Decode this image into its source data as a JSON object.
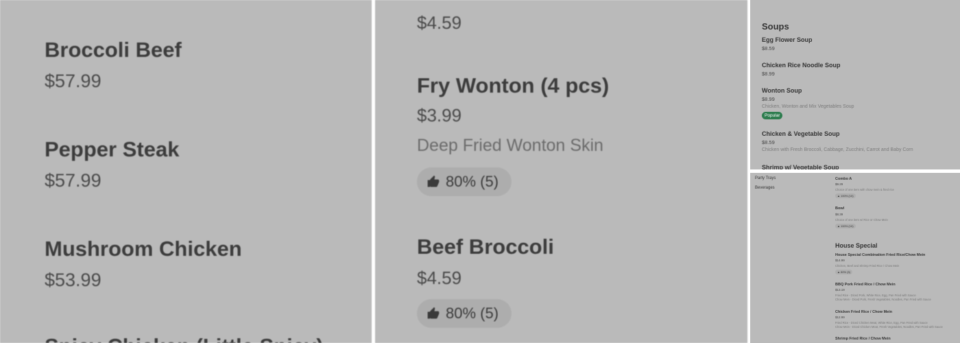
{
  "panel1": {
    "items": [
      {
        "name": "Broccoli Beef",
        "price": "$57.99"
      },
      {
        "name": "Pepper Steak",
        "price": "$57.99"
      },
      {
        "name": "Mushroom Chicken",
        "price": "$53.99"
      },
      {
        "name": "Spicy Chicken (Little Spicy)",
        "price": ""
      }
    ]
  },
  "panel2": {
    "top_price": "$4.59",
    "item1": {
      "name": "Fry Wonton (4 pcs)",
      "price": "$3.99",
      "desc": "Deep Fried Wonton Skin",
      "rating": "80% (5)"
    },
    "item2": {
      "name": "Beef Broccoli",
      "price": "$4.59",
      "rating": "80% (5)"
    }
  },
  "panel3": {
    "section": "Soups",
    "items": [
      {
        "name": "Egg Flower Soup",
        "price": "$8.59"
      },
      {
        "name": "Chicken Rice Noodle Soup",
        "price": "$8.99"
      },
      {
        "name": "Wonton Soup",
        "price": "$8.99",
        "desc": "Chicken, Wonton and Mix Vegetables Soup",
        "badge": "Popular"
      },
      {
        "name": "Chicken & Vegetable Soup",
        "price": "$8.59",
        "desc": "Chicken with Fresh Broccoli, Cabbage, Zucchini, Carrot and Baby Corn"
      },
      {
        "name": "Shrimp w/ Vegetable Soup"
      }
    ]
  },
  "panel4": {
    "nav": [
      "Party Trays",
      "Beverages"
    ],
    "combo_a": {
      "name": "Combo A",
      "price": "$9.29",
      "desc": "Choice of one item with chow mein & fried rice",
      "rating": "100% (10)"
    },
    "bowl": {
      "name": "Bowl",
      "price": "$8.39",
      "desc": "Choice of one item w/ Rice or Chow Mein",
      "rating": "100% (10)"
    },
    "section": "House Special",
    "items": [
      {
        "name": "House Special Combination Fried Rice/Chow Mein",
        "price": "$14.99",
        "desc": "Chicken, Beef and Shrimp Fried Rice / Chow Mein",
        "rating": "80% (5)"
      },
      {
        "name": "BBQ Pork Fried Rice / Chow Mein",
        "price": "$13.19",
        "desc1": "Fried Rice - Diced Pork, White Rice, Egg, Pan Fried with Sauce",
        "desc2": "Chow Mein - Diced Pork, Fresh Vegetables, Noodles, Pan Fried with Sauce"
      },
      {
        "name": "Chicken Fried Rice / Chow Mein",
        "price": "$12.99",
        "desc1": "Fried Rice - Diced Chicken Meat, White Rice, Egg, Pan Fried with Sauce",
        "desc2": "Chow Mein - Diced Chicken Meat, Fresh Vegetables, Noodles, Pan Fried with Sauce"
      },
      {
        "name": "Shrimp Fried Rice / Chow Mein"
      }
    ]
  }
}
